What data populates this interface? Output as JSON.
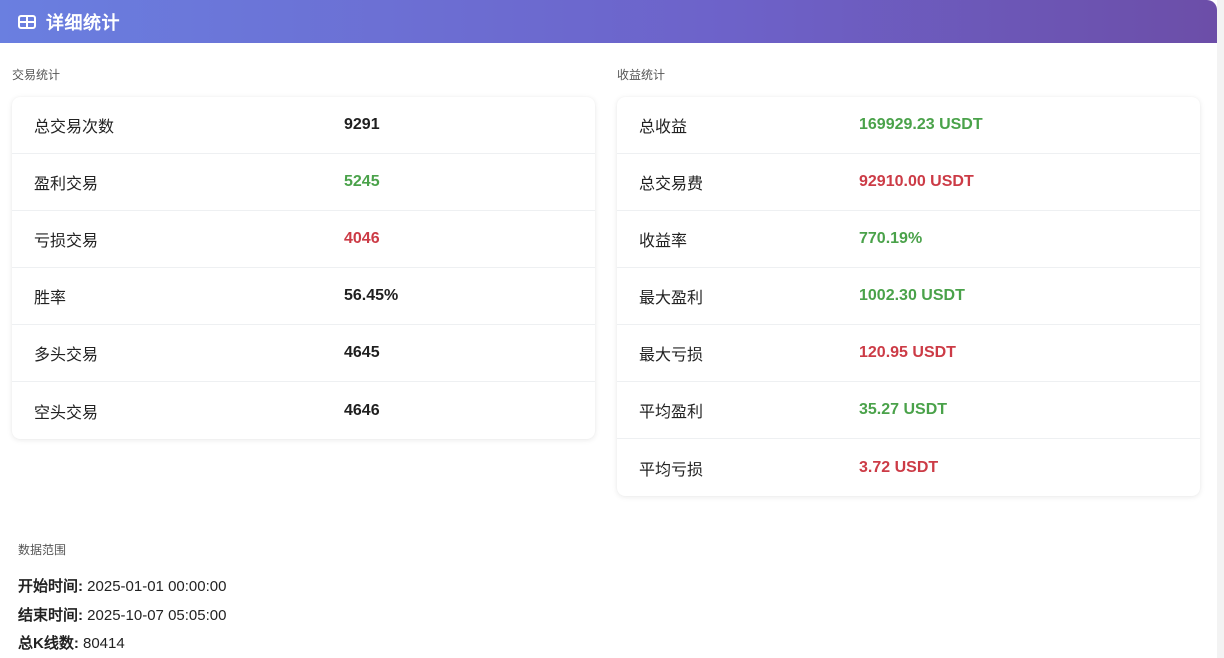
{
  "header": {
    "title": "详细统计",
    "icon": "table-icon"
  },
  "trade_stats": {
    "label": "交易统计",
    "rows": [
      {
        "key": "总交易次数",
        "value": "9291",
        "tone": "dark"
      },
      {
        "key": "盈利交易",
        "value": "5245",
        "tone": "green"
      },
      {
        "key": "亏损交易",
        "value": "4046",
        "tone": "red"
      },
      {
        "key": "胜率",
        "value": "56.45%",
        "tone": "dark"
      },
      {
        "key": "多头交易",
        "value": "4645",
        "tone": "dark"
      },
      {
        "key": "空头交易",
        "value": "4646",
        "tone": "dark"
      }
    ]
  },
  "profit_stats": {
    "label": "收益统计",
    "rows": [
      {
        "key": "总收益",
        "value": "169929.23 USDT",
        "tone": "green"
      },
      {
        "key": "总交易费",
        "value": "92910.00 USDT",
        "tone": "red"
      },
      {
        "key": "收益率",
        "value": "770.19%",
        "tone": "green"
      },
      {
        "key": "最大盈利",
        "value": "1002.30 USDT",
        "tone": "green"
      },
      {
        "key": "最大亏损",
        "value": "120.95 USDT",
        "tone": "red"
      },
      {
        "key": "平均盈利",
        "value": "35.27 USDT",
        "tone": "green"
      },
      {
        "key": "平均亏损",
        "value": "3.72 USDT",
        "tone": "red"
      }
    ]
  },
  "data_range": {
    "label": "数据范围",
    "start_label": "开始时间:",
    "start_value": "2025-01-01 00:00:00",
    "end_label": "结束时间:",
    "end_value": "2025-10-07 05:05:00",
    "count_label": "总K线数:",
    "count_value": "80414"
  },
  "colors": {
    "header_gradient_start": "#6a7fe0",
    "header_gradient_end": "#6c4ea8",
    "positive": "#4aa24a",
    "negative": "#cc3b46",
    "neutral": "#1f1f1f"
  }
}
